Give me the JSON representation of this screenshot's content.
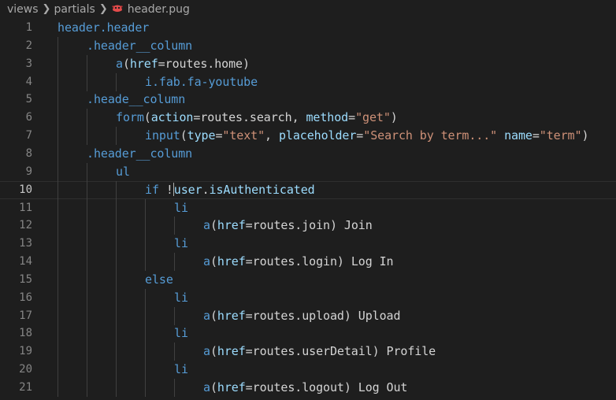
{
  "breadcrumb": {
    "items": [
      "views",
      "partials",
      "header.pug"
    ],
    "file_icon": "pug-icon",
    "file_icon_color": "#e44b4b"
  },
  "colors": {
    "background": "#1e1e1e",
    "line_number": "#858585",
    "tag": "#569cd6",
    "attribute": "#9cdcfe",
    "string": "#ce9178",
    "keyword": "#c586c0",
    "text": "#d4d4d4"
  },
  "editor": {
    "current_line": 10,
    "lines": [
      {
        "n": "1",
        "indent": 0,
        "tokens": [
          [
            "tag",
            "header"
          ],
          [
            "cls2",
            ".header"
          ]
        ]
      },
      {
        "n": "2",
        "indent": 1,
        "tokens": [
          [
            "cls2",
            ".header__column"
          ]
        ]
      },
      {
        "n": "3",
        "indent": 2,
        "tokens": [
          [
            "tag",
            "a"
          ],
          [
            "punc",
            "("
          ],
          [
            "attr",
            "href"
          ],
          [
            "punc",
            "="
          ],
          [
            "txt",
            "routes.home"
          ],
          [
            "punc",
            ")"
          ]
        ]
      },
      {
        "n": "4",
        "indent": 3,
        "tokens": [
          [
            "tag",
            "i"
          ],
          [
            "cls2",
            ".fab.fa-youtube"
          ]
        ]
      },
      {
        "n": "5",
        "indent": 1,
        "tokens": [
          [
            "cls2",
            ".heade__column"
          ]
        ]
      },
      {
        "n": "6",
        "indent": 2,
        "tokens": [
          [
            "tag",
            "form"
          ],
          [
            "punc",
            "("
          ],
          [
            "attr",
            "action"
          ],
          [
            "punc",
            "="
          ],
          [
            "txt",
            "routes.search"
          ],
          [
            "punc",
            ", "
          ],
          [
            "attr",
            "method"
          ],
          [
            "punc",
            "="
          ],
          [
            "str",
            "\"get\""
          ],
          [
            "punc",
            ")"
          ]
        ]
      },
      {
        "n": "7",
        "indent": 3,
        "tokens": [
          [
            "tag",
            "input"
          ],
          [
            "punc",
            "("
          ],
          [
            "attr",
            "type"
          ],
          [
            "punc",
            "="
          ],
          [
            "str",
            "\"text\""
          ],
          [
            "punc",
            ", "
          ],
          [
            "attr",
            "placeholder"
          ],
          [
            "punc",
            "="
          ],
          [
            "str",
            "\"Search by term...\""
          ],
          [
            "punc",
            " "
          ],
          [
            "attr",
            "name"
          ],
          [
            "punc",
            "="
          ],
          [
            "str",
            "\"term\""
          ],
          [
            "punc",
            ")"
          ]
        ]
      },
      {
        "n": "8",
        "indent": 1,
        "tokens": [
          [
            "cls2",
            ".header__column"
          ]
        ]
      },
      {
        "n": "9",
        "indent": 2,
        "tokens": [
          [
            "tag",
            "ul"
          ]
        ]
      },
      {
        "n": "10",
        "indent": 3,
        "tokens": [
          [
            "tag",
            "if"
          ],
          [
            "punc",
            " "
          ],
          [
            "txt",
            "!"
          ],
          [
            "cursor",
            ""
          ],
          [
            "attr",
            "user"
          ],
          [
            "txt",
            "."
          ],
          [
            "attr",
            "isAuthenticated"
          ]
        ]
      },
      {
        "n": "11",
        "indent": 4,
        "tokens": [
          [
            "tag",
            "li"
          ]
        ]
      },
      {
        "n": "12",
        "indent": 5,
        "tokens": [
          [
            "tag",
            "a"
          ],
          [
            "punc",
            "("
          ],
          [
            "attr",
            "href"
          ],
          [
            "punc",
            "="
          ],
          [
            "txt",
            "routes.join"
          ],
          [
            "punc",
            ")"
          ],
          [
            "txt",
            " Join"
          ]
        ]
      },
      {
        "n": "13",
        "indent": 4,
        "tokens": [
          [
            "tag",
            "li"
          ]
        ]
      },
      {
        "n": "14",
        "indent": 5,
        "tokens": [
          [
            "tag",
            "a"
          ],
          [
            "punc",
            "("
          ],
          [
            "attr",
            "href"
          ],
          [
            "punc",
            "="
          ],
          [
            "txt",
            "routes.login"
          ],
          [
            "punc",
            ")"
          ],
          [
            "txt",
            " Log In"
          ]
        ]
      },
      {
        "n": "15",
        "indent": 3,
        "tokens": [
          [
            "tag",
            "else"
          ]
        ]
      },
      {
        "n": "16",
        "indent": 4,
        "tokens": [
          [
            "tag",
            "li"
          ]
        ]
      },
      {
        "n": "17",
        "indent": 5,
        "tokens": [
          [
            "tag",
            "a"
          ],
          [
            "punc",
            "("
          ],
          [
            "attr",
            "href"
          ],
          [
            "punc",
            "="
          ],
          [
            "txt",
            "routes.upload"
          ],
          [
            "punc",
            ")"
          ],
          [
            "txt",
            " Upload"
          ]
        ]
      },
      {
        "n": "18",
        "indent": 4,
        "tokens": [
          [
            "tag",
            "li"
          ]
        ]
      },
      {
        "n": "19",
        "indent": 5,
        "tokens": [
          [
            "tag",
            "a"
          ],
          [
            "punc",
            "("
          ],
          [
            "attr",
            "href"
          ],
          [
            "punc",
            "="
          ],
          [
            "txt",
            "routes.userDetail"
          ],
          [
            "punc",
            ")"
          ],
          [
            "txt",
            " Profile"
          ]
        ]
      },
      {
        "n": "20",
        "indent": 4,
        "tokens": [
          [
            "tag",
            "li"
          ]
        ]
      },
      {
        "n": "21",
        "indent": 5,
        "tokens": [
          [
            "tag",
            "a"
          ],
          [
            "punc",
            "("
          ],
          [
            "attr",
            "href"
          ],
          [
            "punc",
            "="
          ],
          [
            "txt",
            "routes.logout"
          ],
          [
            "punc",
            ")"
          ],
          [
            "txt",
            " Log Out"
          ]
        ]
      }
    ]
  }
}
